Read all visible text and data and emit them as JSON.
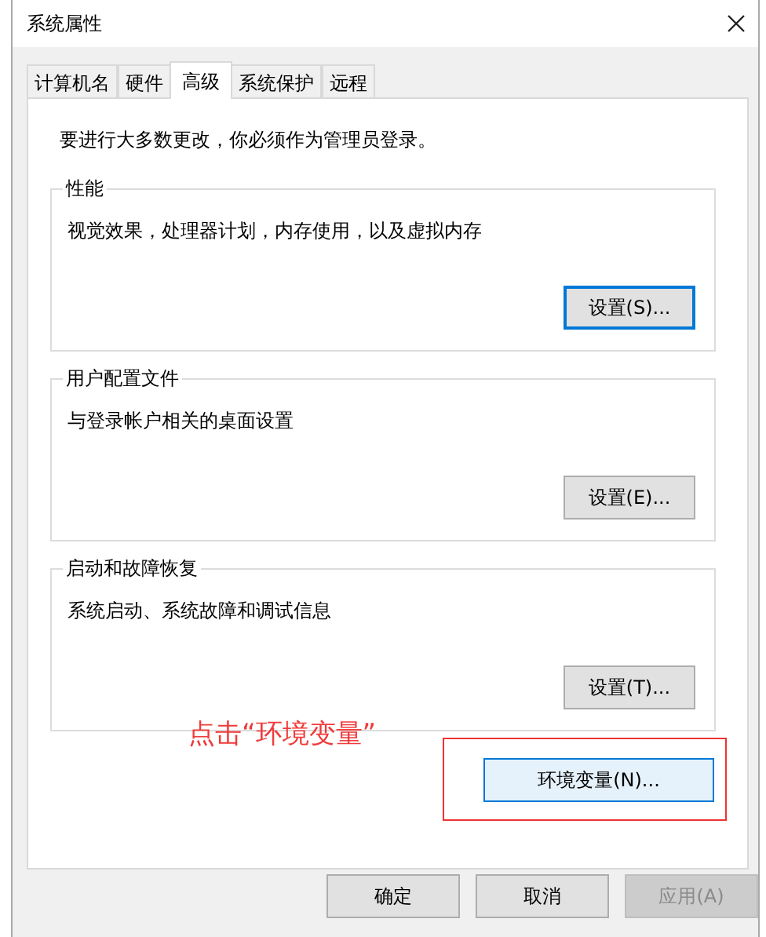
{
  "window": {
    "title": "系统属性"
  },
  "tabs": [
    {
      "label": "计算机名",
      "selected": false
    },
    {
      "label": "硬件",
      "selected": false
    },
    {
      "label": "高级",
      "selected": true
    },
    {
      "label": "系统保护",
      "selected": false
    },
    {
      "label": "远程",
      "selected": false
    }
  ],
  "notice": "要进行大多数更改，你必须作为管理员登录。",
  "groups": [
    {
      "title": "性能",
      "description": "视觉效果，处理器计划，内存使用，以及虚拟内存",
      "button": {
        "label": "设置(S)...",
        "focused": true
      }
    },
    {
      "title": "用户配置文件",
      "description": "与登录帐户相关的桌面设置",
      "button": {
        "label": "设置(E)...",
        "focused": false
      }
    },
    {
      "title": "启动和故障恢复",
      "description": "系统启动、系统故障和调试信息",
      "button": {
        "label": "设置(T)...",
        "focused": false
      }
    }
  ],
  "environment_button": {
    "label": "环境变量(N)...",
    "hovered": true
  },
  "annotation": {
    "text": "点击“环境变量”"
  },
  "buttons": [
    {
      "label": "确定",
      "disabled": false
    },
    {
      "label": "取消",
      "disabled": false
    },
    {
      "label": "应用(A)",
      "disabled": true
    }
  ]
}
